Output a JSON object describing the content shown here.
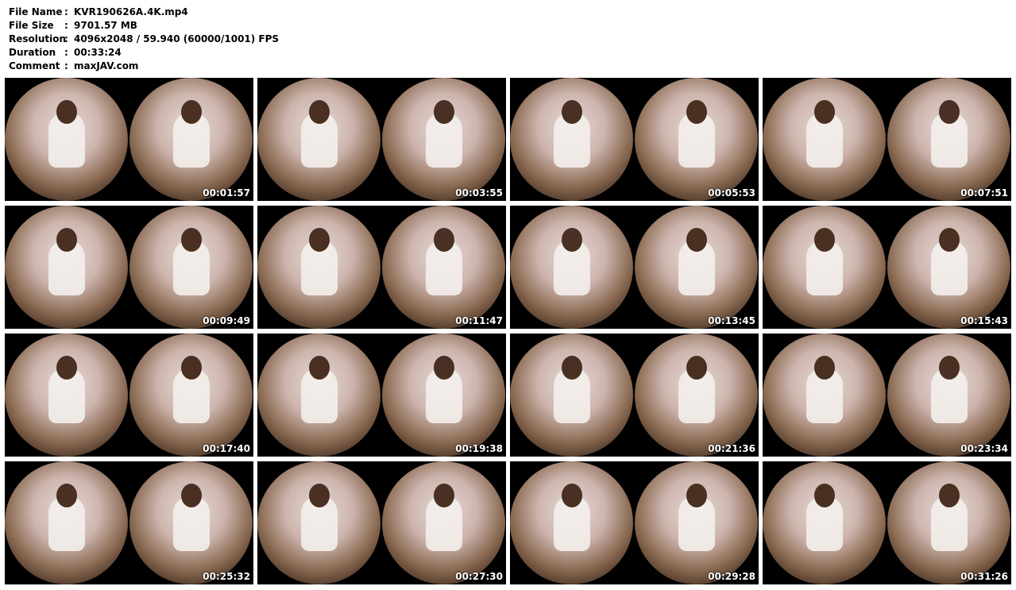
{
  "info": [
    {
      "label": "File Name",
      "sep": ":",
      "value": "KVR190626A.4K.mp4"
    },
    {
      "label": "File Size",
      "sep": ":",
      "value": "9701.57 MB"
    },
    {
      "label": "Resolution",
      "sep": ":",
      "value": "4096x2048 / 59.940 (60000/1001) FPS"
    },
    {
      "label": "Duration",
      "sep": ":",
      "value": "00:33:24"
    },
    {
      "label": "Comment",
      "sep": ":",
      "value": "maxJAV.com"
    }
  ],
  "thumbnails": [
    {
      "timestamp": "00:01:57"
    },
    {
      "timestamp": "00:03:55"
    },
    {
      "timestamp": "00:05:53"
    },
    {
      "timestamp": "00:07:51"
    },
    {
      "timestamp": "00:09:49"
    },
    {
      "timestamp": "00:11:47"
    },
    {
      "timestamp": "00:13:45"
    },
    {
      "timestamp": "00:15:43"
    },
    {
      "timestamp": "00:17:40"
    },
    {
      "timestamp": "00:19:38"
    },
    {
      "timestamp": "00:21:36"
    },
    {
      "timestamp": "00:23:34"
    },
    {
      "timestamp": "00:25:32"
    },
    {
      "timestamp": "00:27:30"
    },
    {
      "timestamp": "00:29:28"
    },
    {
      "timestamp": "00:31:26"
    }
  ]
}
